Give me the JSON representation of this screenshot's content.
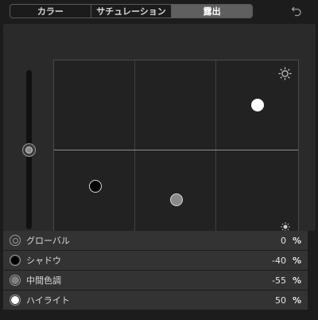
{
  "tabs": [
    {
      "label": "カラー"
    },
    {
      "label": "サチュレーション"
    },
    {
      "label": "露出"
    }
  ],
  "active_tab": 2,
  "undo_icon": "undo-icon",
  "board": {
    "bright_icon": "sun-large-icon",
    "dim_icon": "sun-small-icon",
    "global_slider_percent": 0,
    "pucks": [
      {
        "name": "shadows-puck",
        "color": "#000000"
      },
      {
        "name": "midtones-puck",
        "color": "#8a8a8a"
      },
      {
        "name": "highlights-puck",
        "color": "#ffffff"
      }
    ]
  },
  "rows": [
    {
      "label": "グローバル",
      "value": "0",
      "unit": "%",
      "icon": "global-ring-icon",
      "color": "#8a8a8a"
    },
    {
      "label": "シャドウ",
      "value": "-40",
      "unit": "%",
      "icon": "shadows-ring-icon",
      "color": "#000000"
    },
    {
      "label": "中間色調",
      "value": "-55",
      "unit": "%",
      "icon": "midtones-ring-icon",
      "color": "#8a8a8a"
    },
    {
      "label": "ハイライト",
      "value": "50",
      "unit": "%",
      "icon": "highlights-ring-icon",
      "color": "#ffffff"
    }
  ]
}
